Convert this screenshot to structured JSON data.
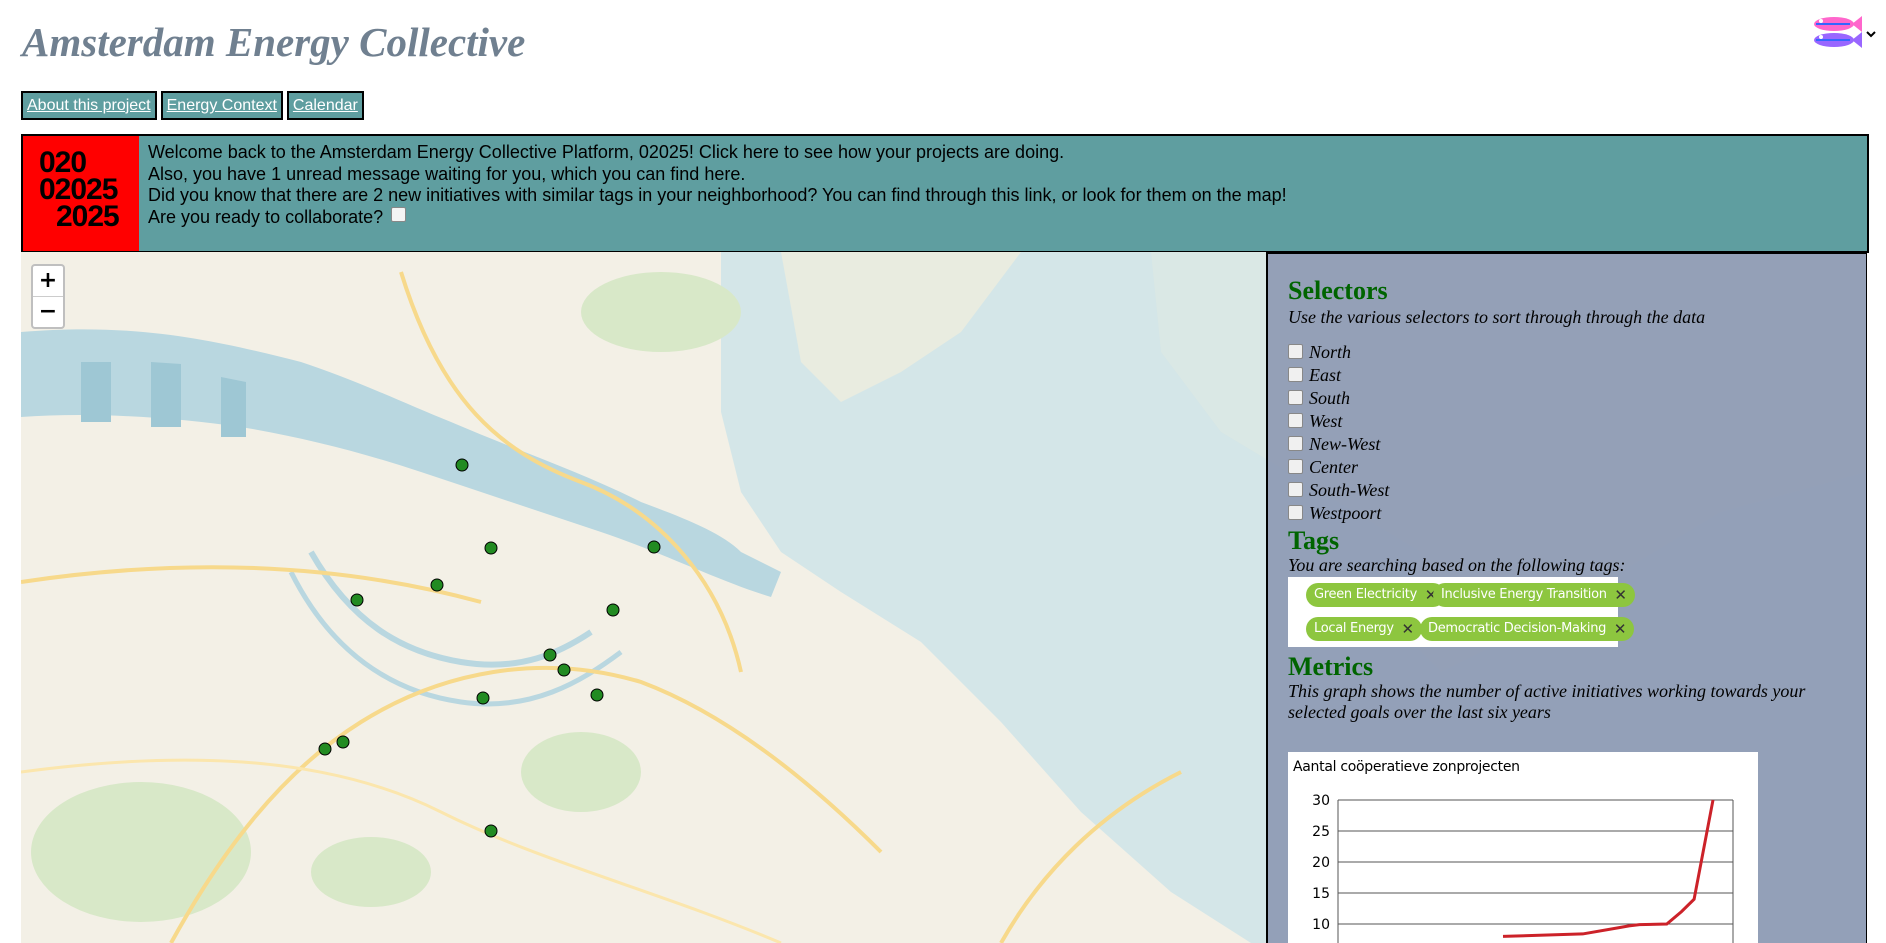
{
  "header": {
    "title": "Amsterdam Energy Collective"
  },
  "nav": {
    "items": [
      "About this project",
      "Energy Context",
      "Calendar"
    ]
  },
  "banner": {
    "logo_lines": [
      "020",
      "02025",
      "2025"
    ],
    "logo_color": "#ff0000",
    "background": "#5f9ea0",
    "line1": "Welcome back to the Amsterdam Energy Collective Platform, 02025! Click here to see how your projects are doing.",
    "line2": "Also, you have 1 unread message waiting for you, which you can find here.",
    "line3": "Did you know that there are 2 new initiatives with similar tags in your neighborhood? You can find through this link, or look for them on the map!",
    "line4": "Are you ready to collaborate?"
  },
  "map": {
    "zoom_in": "+",
    "zoom_out": "−",
    "marker_color": "#228b22"
  },
  "panel": {
    "selectors": {
      "heading": "Selectors",
      "subtext": "Use the various selectors to sort through through the data",
      "regions": [
        "North",
        "East",
        "South",
        "West",
        "New-West",
        "Center",
        "South-West",
        "Westpoort"
      ]
    },
    "tags": {
      "heading": "Tags",
      "subtext": "You are searching based on the following tags:",
      "items": [
        "Green Electricity",
        "Inclusive Energy Transition",
        "Local Energy",
        "Democratic Decision-Making"
      ],
      "color": "#8dc63f"
    },
    "metrics": {
      "heading": "Metrics",
      "subtext": "This graph shows the number of active initiatives working towards your selected goals over the last six years"
    }
  },
  "chart_data": {
    "type": "line",
    "title": "Aantal coöperatieve zonprojecten",
    "y_ticks": [
      10,
      15,
      20,
      25,
      30
    ],
    "ylim": [
      8,
      30
    ],
    "points": [
      [
        0.0,
        8
      ],
      [
        0.38,
        8.4
      ],
      [
        0.55,
        9.4
      ],
      [
        0.6,
        9.7
      ],
      [
        0.65,
        9.9
      ],
      [
        0.78,
        10
      ],
      [
        0.85,
        12
      ],
      [
        0.91,
        14
      ],
      [
        1.0,
        30
      ]
    ],
    "line_color": "#cc2229"
  }
}
